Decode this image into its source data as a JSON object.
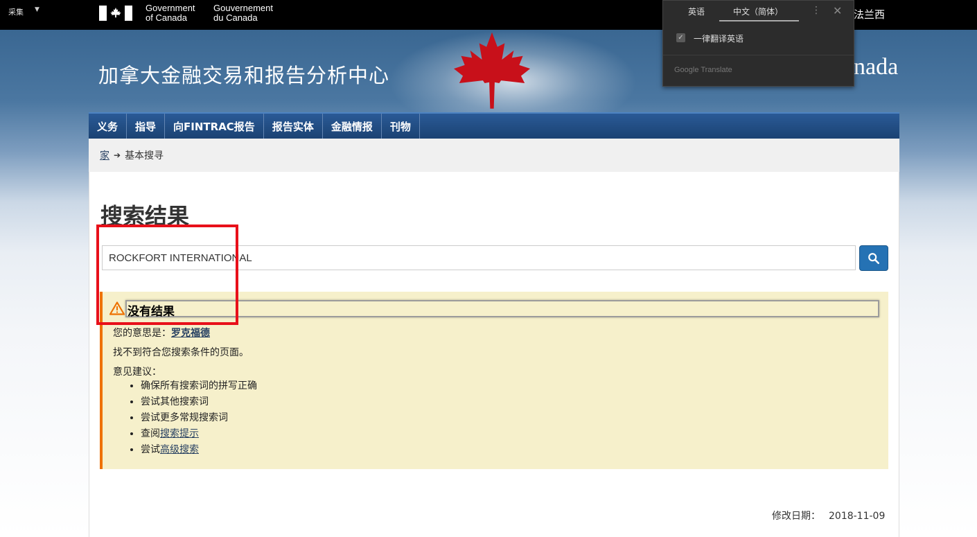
{
  "gov_bar": {
    "collect_label": "采集",
    "gov_en_line1": "Government",
    "gov_en_line2": "of Canada",
    "gov_fr_line1": "Gouvernement",
    "gov_fr_line2": "du Canada",
    "language_link": "法兰西"
  },
  "banner": {
    "site_title": "加拿大金融交易和报告分析中心",
    "wordmark": "nada"
  },
  "nav": {
    "items": [
      "义务",
      "指导",
      "向FINTRAC报告",
      "报告实体",
      "金融情报",
      "刊物"
    ]
  },
  "breadcrumb": {
    "home": "家",
    "current": "基本搜寻"
  },
  "page_title": "搜索结果",
  "search": {
    "value": "ROCKFORT INTERNATIONAL"
  },
  "alert": {
    "title": "没有结果",
    "did_you_mean_prefix": "您的意思是：",
    "did_you_mean_link": "罗克福德",
    "not_found": "找不到符合您搜索条件的页面。",
    "suggestions_label": "意见建议：",
    "suggestions": [
      {
        "text": "确保所有搜索词的拼写正确",
        "link": ""
      },
      {
        "text": "尝试其他搜索词",
        "link": ""
      },
      {
        "text": "尝试更多常规搜索词",
        "link": ""
      },
      {
        "text": "查阅",
        "link": "搜索提示"
      },
      {
        "text": "尝试",
        "link": "高级搜索"
      }
    ]
  },
  "footer": {
    "modified_label": "修改日期：",
    "modified_date": "2018-11-09"
  },
  "translate_popup": {
    "tab_english": "英语",
    "tab_chinese": "中文（简体）",
    "always_translate": "一律翻译英语",
    "brand": "Google Translate"
  },
  "colors": {
    "nav_bg": "#1b4273",
    "alert_bg": "#f6f0cb",
    "alert_border": "#ee7100",
    "search_button": "#2572b4",
    "highlight_box": "#e8101a",
    "link": "#284162"
  }
}
